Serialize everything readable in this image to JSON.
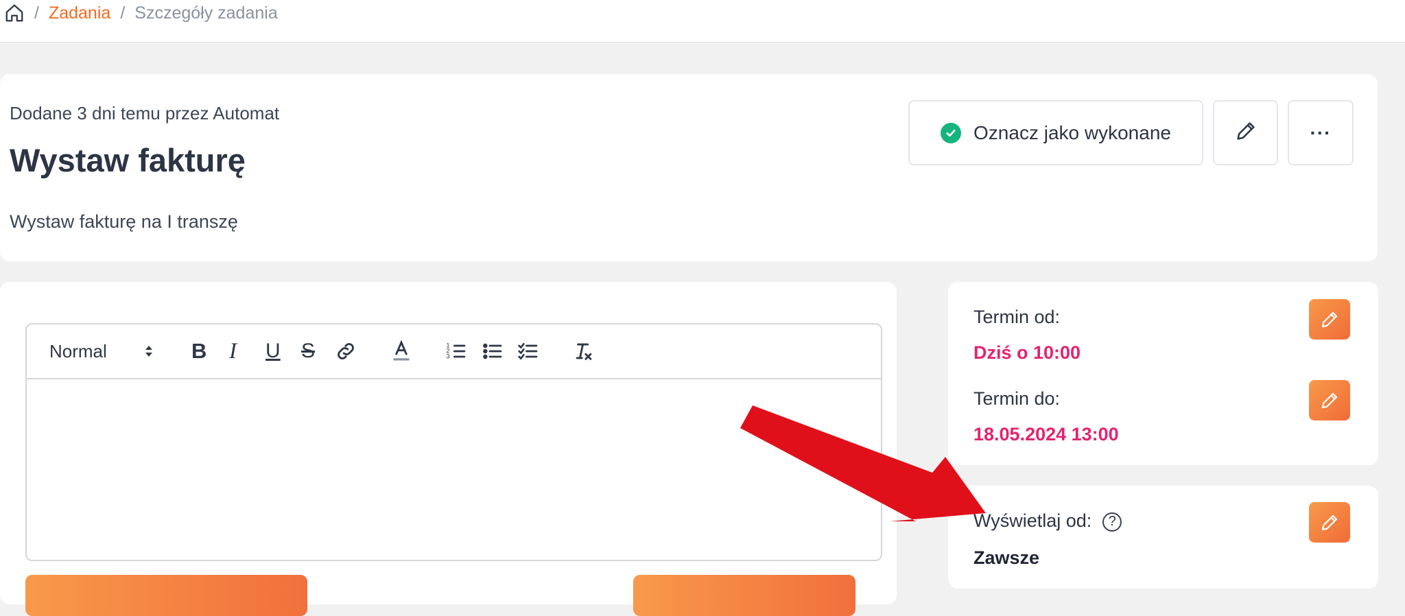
{
  "breadcrumb": {
    "home_icon": "home-icon",
    "separator": "/",
    "items": [
      "Zadania",
      "Szczegóły zadania"
    ]
  },
  "task": {
    "meta": "Dodane 3 dni temu przez Automat",
    "title": "Wystaw fakturę",
    "description": "Wystaw fakturę na I transzę"
  },
  "actions": {
    "mark_done": "Oznacz jako wykonane",
    "check_icon": "check-circle-icon",
    "edit_icon": "pencil-icon",
    "more": "···"
  },
  "editor": {
    "format_value": "Normal",
    "tools": [
      "B",
      "I",
      "U",
      "S",
      "link",
      "text-color",
      "ordered-list",
      "bullet-list",
      "check-list",
      "clear-format"
    ],
    "content": ""
  },
  "dates": {
    "from_label": "Termin od:",
    "from_value": "Dziś o 10:00",
    "to_label": "Termin do:",
    "to_value": "18.05.2024 13:00"
  },
  "display": {
    "label": "Wyświetlaj od:",
    "help": "?",
    "value": "Zawsze"
  },
  "colors": {
    "accent": "#f26a21",
    "deadline": "#e4236f",
    "success": "#15b47e",
    "annotation_arrow": "#e0101b"
  }
}
